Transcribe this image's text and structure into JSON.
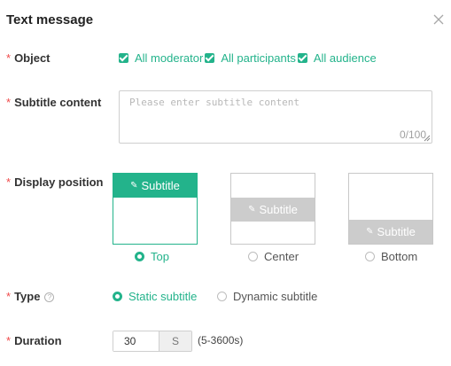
{
  "dialog": {
    "title": "Text message"
  },
  "colors": {
    "accent": "#23b38b",
    "required": "#f04a4a",
    "inactive": "#cccccc"
  },
  "object": {
    "label": "Object",
    "options": [
      {
        "label": "All moderator",
        "checked": true
      },
      {
        "label": "All participants",
        "checked": true
      },
      {
        "label": "All audience",
        "checked": true
      }
    ]
  },
  "subtitle_content": {
    "label": "Subtitle content",
    "placeholder": "Please enter subtitle content",
    "value": "",
    "counter": "0/100"
  },
  "display_position": {
    "label": "Display position",
    "preview_text": "Subtitle",
    "options": [
      {
        "label": "Top",
        "selected": true
      },
      {
        "label": "Center",
        "selected": false
      },
      {
        "label": "Bottom",
        "selected": false
      }
    ]
  },
  "type": {
    "label": "Type",
    "options": [
      {
        "label": "Static subtitle",
        "selected": true
      },
      {
        "label": "Dynamic subtitle",
        "selected": false
      }
    ]
  },
  "duration": {
    "label": "Duration",
    "value": "30",
    "unit": "S",
    "range": "(5-3600s)"
  },
  "icons": {
    "close": "close-icon",
    "help": "question-circle-icon",
    "preview": "megaphone-icon"
  }
}
